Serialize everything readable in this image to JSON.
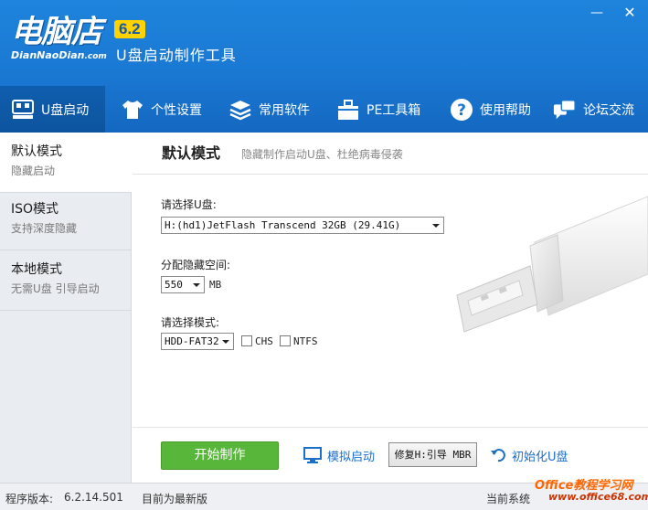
{
  "app": {
    "brand_cn": "电脑店",
    "brand_en": "DianNaoDian",
    "brand_en_suffix": ".com",
    "version_badge": "6.2",
    "subtitle": "U盘启动制作工具",
    "minimize": "—",
    "close": "✕"
  },
  "nav": {
    "items": [
      {
        "label": "U盘启动",
        "icon": "usb-drive-icon"
      },
      {
        "label": "个性设置",
        "icon": "tshirt-icon"
      },
      {
        "label": "常用软件",
        "icon": "layers-icon"
      },
      {
        "label": "PE工具箱",
        "icon": "toolbox-icon"
      },
      {
        "label": "使用帮助",
        "icon": "help-icon"
      },
      {
        "label": "论坛交流",
        "icon": "chat-icon"
      }
    ],
    "active_index": 0
  },
  "sidebar": {
    "items": [
      {
        "title": "默认模式",
        "desc": "隐藏启动"
      },
      {
        "title": "ISO模式",
        "desc": "支持深度隐藏"
      },
      {
        "title": "本地模式",
        "desc": "无需U盘 引导启动"
      }
    ],
    "active_index": 0
  },
  "main": {
    "title": "默认模式",
    "desc": "隐藏制作启动U盘、杜绝病毒侵袭",
    "usb_label": "请选择U盘:",
    "usb_value": "H:(hd1)JetFlash Transcend 32GB (29.41G)",
    "hidden_label": "分配隐藏空间:",
    "hidden_value": "550",
    "hidden_unit": "MB",
    "mode_label": "请选择模式:",
    "mode_value": "HDD-FAT32",
    "chs_label": "CHS",
    "chs_checked": false,
    "ntfs_label": "NTFS",
    "ntfs_checked": false
  },
  "actions": {
    "start": "开始制作",
    "simulate": "模拟启动",
    "repair": "修复H:引导 MBR",
    "init": "初始化U盘"
  },
  "status": {
    "version_label": "程序版本:",
    "version": "6.2.14.501",
    "latest": "目前为最新版",
    "right_text": "当前系统"
  },
  "watermark": {
    "line1": "Office教程学习网",
    "line2": "www.office68.com"
  },
  "colors": {
    "header_blue": "#1a78d3",
    "active_nav": "#0f5eae",
    "start_green": "#58b73a",
    "link_blue": "#1a6fc9",
    "version_yellow": "#ffd200"
  }
}
